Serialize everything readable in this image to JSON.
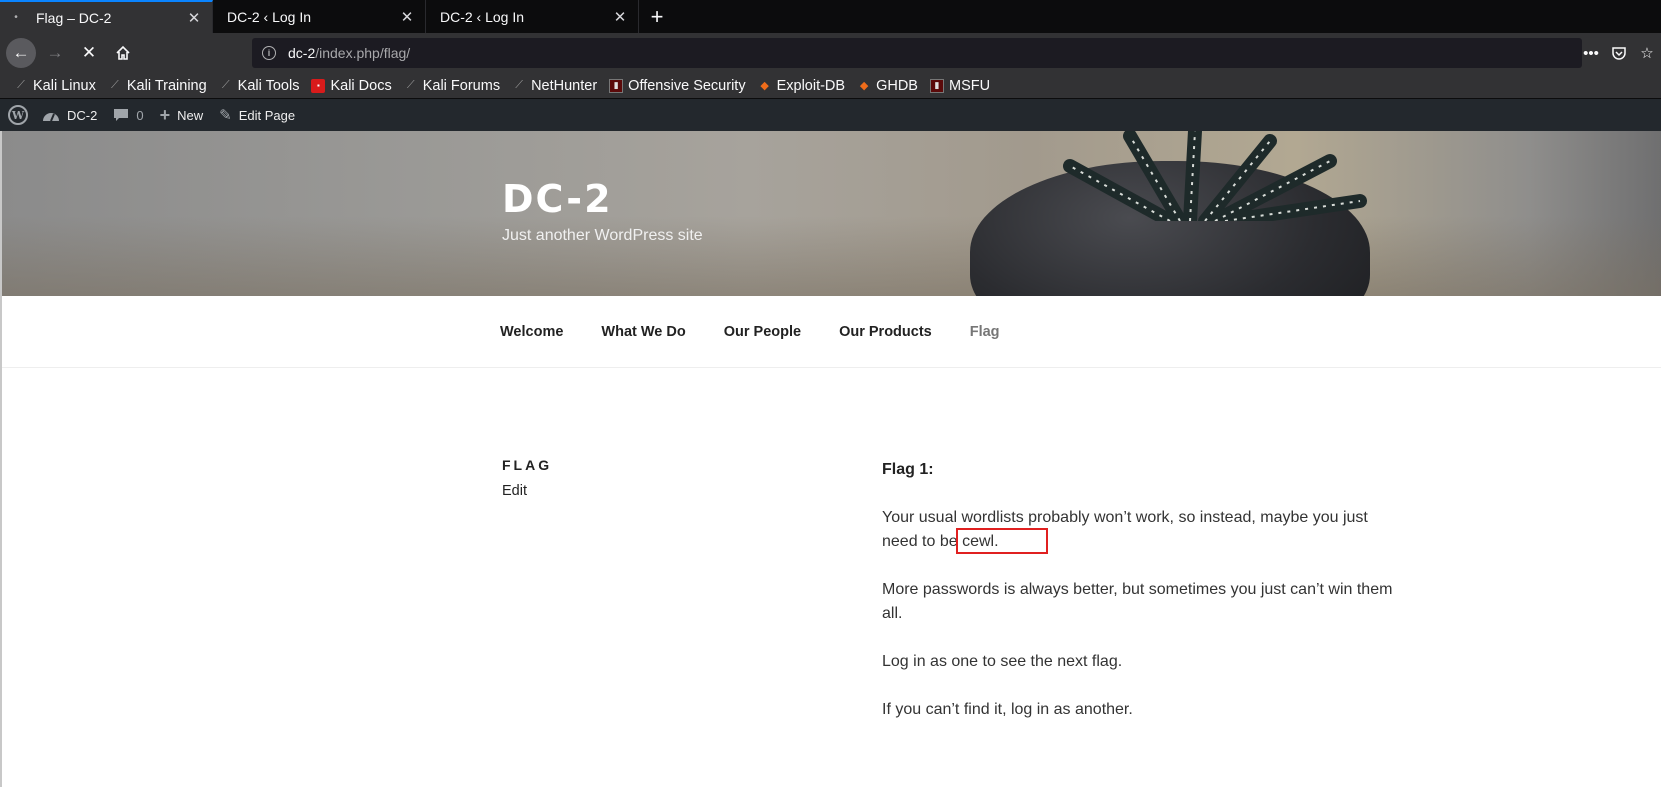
{
  "browser": {
    "tabs": [
      {
        "title": "Flag – DC-2",
        "active": true
      },
      {
        "title": "DC-2 ‹ Log In",
        "active": false
      },
      {
        "title": "DC-2 ‹ Log In",
        "active": false
      }
    ],
    "url_host": "dc-2",
    "url_path": "/index.php/flag/",
    "bookmarks": [
      {
        "label": "Kali Linux",
        "icon": "kali-icon"
      },
      {
        "label": "Kali Training",
        "icon": "kali-icon"
      },
      {
        "label": "Kali Tools",
        "icon": "kali-icon"
      },
      {
        "label": "Kali Docs",
        "icon": "kali-docs-icon"
      },
      {
        "label": "Kali Forums",
        "icon": "kali-icon"
      },
      {
        "label": "NetHunter",
        "icon": "kali-icon"
      },
      {
        "label": "Offensive Security",
        "icon": "offsec-icon"
      },
      {
        "label": "Exploit-DB",
        "icon": "exploit-db-icon"
      },
      {
        "label": "GHDB",
        "icon": "exploit-db-icon"
      },
      {
        "label": "MSFU",
        "icon": "offsec-icon"
      }
    ]
  },
  "admin_bar": {
    "site_name": "DC-2",
    "comments_count": "0",
    "new_label": "New",
    "edit_label": "Edit Page"
  },
  "site": {
    "title": "DC-2",
    "description": "Just another WordPress site"
  },
  "menu": [
    {
      "label": "Welcome",
      "current": false
    },
    {
      "label": "What We Do",
      "current": false
    },
    {
      "label": "Our People",
      "current": false
    },
    {
      "label": "Our Products",
      "current": false
    },
    {
      "label": "Flag",
      "current": true
    }
  ],
  "page": {
    "heading": "FLAG",
    "edit_link": "Edit",
    "flag_title": "Flag 1:",
    "paragraphs": [
      "Your usual wordlists probably won’t work, so instead, maybe you just need to be cewl.",
      "More passwords is always better, but sometimes you just can’t win them all.",
      "Log in as one to see the next flag.",
      "If you can’t find it, log in as another."
    ]
  },
  "colors": {
    "accent": "#0a84ff",
    "admin_bar": "#23282d",
    "highlight_box": "#e02020"
  }
}
